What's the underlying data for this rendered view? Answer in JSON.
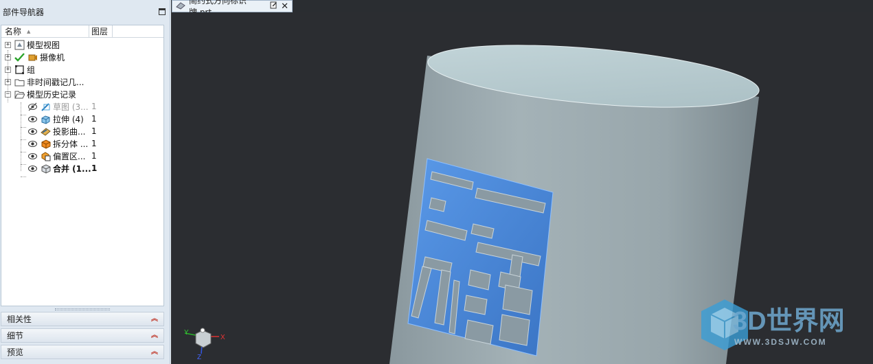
{
  "navigator": {
    "title": "部件导航器",
    "col_name": "名称",
    "col_layer": "图层",
    "tree": [
      {
        "label": "模型视图",
        "layer": "",
        "icon": "model-view-icon"
      },
      {
        "label": "摄像机",
        "layer": "",
        "icon": "camera-icon"
      },
      {
        "label": "组",
        "layer": "",
        "icon": "group-icon"
      },
      {
        "label": "非时间戳记几...",
        "layer": "",
        "icon": "folder-icon"
      },
      {
        "label": "模型历史记录",
        "layer": "",
        "icon": "folder-open-icon"
      },
      {
        "label": "草图 (3...",
        "layer": "1",
        "icon": "sketch-icon"
      },
      {
        "label": "拉伸 (4)",
        "layer": "1",
        "icon": "extrude-icon"
      },
      {
        "label": "投影曲...",
        "layer": "1",
        "icon": "project-curve-icon"
      },
      {
        "label": "拆分体 ...",
        "layer": "1",
        "icon": "split-body-icon"
      },
      {
        "label": "偏置区...",
        "layer": "1",
        "icon": "offset-region-icon"
      },
      {
        "label": "合并 (1...",
        "layer": "1",
        "icon": "unite-icon"
      }
    ],
    "sections": [
      {
        "label": "相关性"
      },
      {
        "label": "细节"
      },
      {
        "label": "预览"
      }
    ]
  },
  "tab": {
    "title": "简约式方向标识牌.prt"
  },
  "watermark": {
    "brand": "3D世界网",
    "url": "WWW.3DSJW.COM"
  },
  "triad": {
    "x": "X",
    "y": "Y",
    "z": "Z"
  },
  "colors": {
    "background": "#2b2d31",
    "cylinder": "#9aa7ad",
    "top_face": "#b6c9ce",
    "emblem": "#4a86d6"
  }
}
